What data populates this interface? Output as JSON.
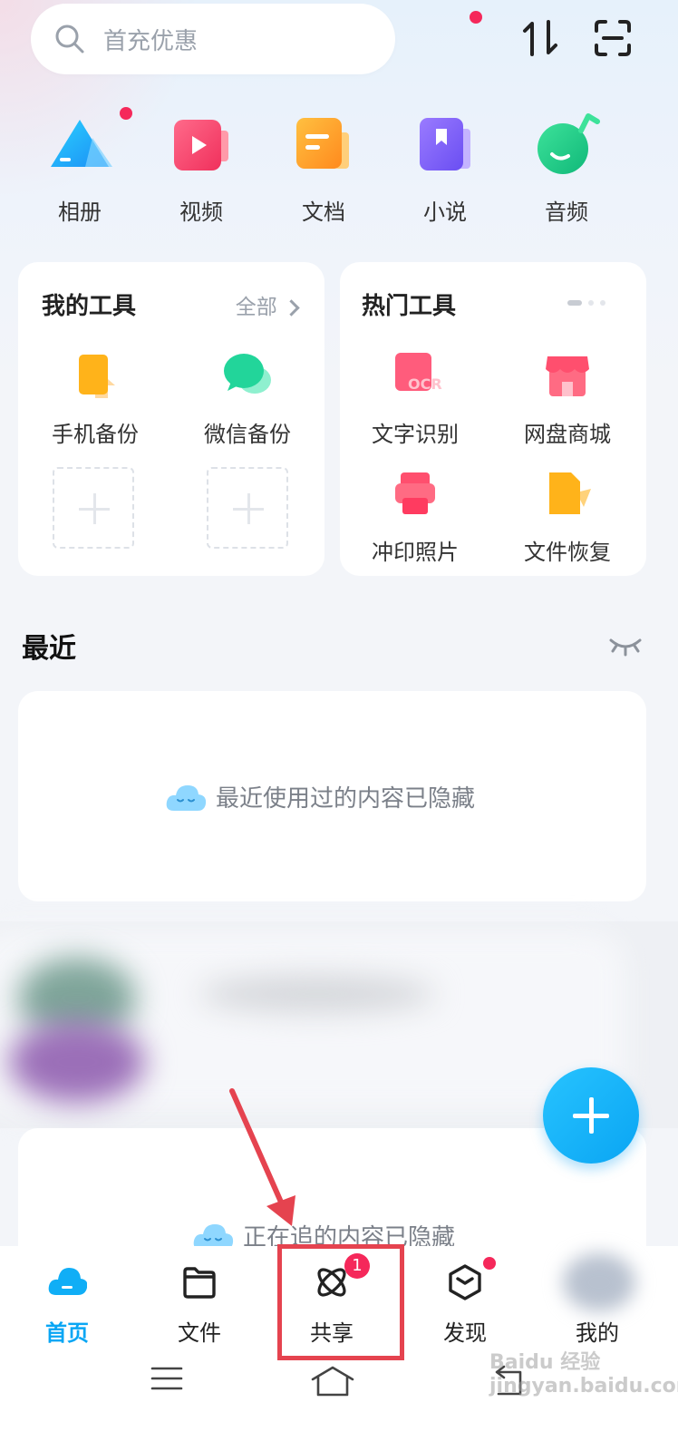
{
  "search": {
    "placeholder": "首充优惠"
  },
  "categories": [
    {
      "label": "相册",
      "icon": "album-icon"
    },
    {
      "label": "视频",
      "icon": "video-icon"
    },
    {
      "label": "文档",
      "icon": "document-icon"
    },
    {
      "label": "小说",
      "icon": "novel-icon"
    },
    {
      "label": "音频",
      "icon": "audio-icon"
    }
  ],
  "my_tools": {
    "title": "我的工具",
    "more": "全部",
    "items": [
      {
        "label": "手机备份",
        "icon": "phone-backup-icon"
      },
      {
        "label": "微信备份",
        "icon": "wechat-backup-icon"
      }
    ]
  },
  "hot_tools": {
    "title": "热门工具",
    "items": [
      {
        "label": "文字识别",
        "icon": "ocr-icon",
        "icon_text": "OCR"
      },
      {
        "label": "网盘商城",
        "icon": "store-icon"
      },
      {
        "label": "冲印照片",
        "icon": "print-photo-icon"
      },
      {
        "label": "文件恢复",
        "icon": "file-recovery-icon"
      }
    ]
  },
  "recent": {
    "title": "最近",
    "hidden_text": "最近使用过的内容已隐藏"
  },
  "following": {
    "hidden_text": "正在追的内容已隐藏"
  },
  "tabs": [
    {
      "label": "首页",
      "icon": "home-cloud-icon",
      "active": true
    },
    {
      "label": "文件",
      "icon": "folder-icon"
    },
    {
      "label": "共享",
      "icon": "share-atom-icon",
      "badge": "1"
    },
    {
      "label": "发现",
      "icon": "discover-cube-icon"
    },
    {
      "label": "我的",
      "icon": "avatar"
    }
  ],
  "watermark": "Baidu 经验 jingyan.baidu.com",
  "colors": {
    "accent": "#09a6f4",
    "badge": "#f5285a",
    "annotation": "#e5434f"
  }
}
